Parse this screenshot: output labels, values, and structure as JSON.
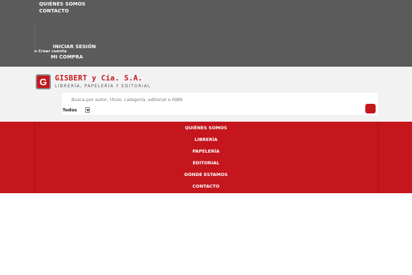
{
  "topbar": {
    "links": {
      "quienes": "QUIÉNES SOMOS",
      "contacto": "CONTACTO",
      "login": "INICIAR SESIÓN",
      "register": "o Crear cuenta",
      "cart": "MI COMPRA"
    }
  },
  "header": {
    "logo": {
      "mark": "G",
      "name": "GISBERT y Cía. S.A.",
      "tagline": "LIBRERÍA, PAPELERÍA Y EDITORIAL"
    },
    "search": {
      "placeholder": "Busca por autor, título, categoría, editorial o ISBN",
      "category": "Todos"
    }
  },
  "nav": {
    "items": [
      "QUIÉNES SOMOS",
      "LIBRERÍA",
      "PAPELERÍA",
      "EDITORIAL",
      "DÓNDE ESTAMOS",
      "CONTACTO"
    ]
  },
  "colors": {
    "brand_red": "#c4161c",
    "topbar_gray": "#5b5b5b",
    "header_bg": "#f2f2f2"
  }
}
